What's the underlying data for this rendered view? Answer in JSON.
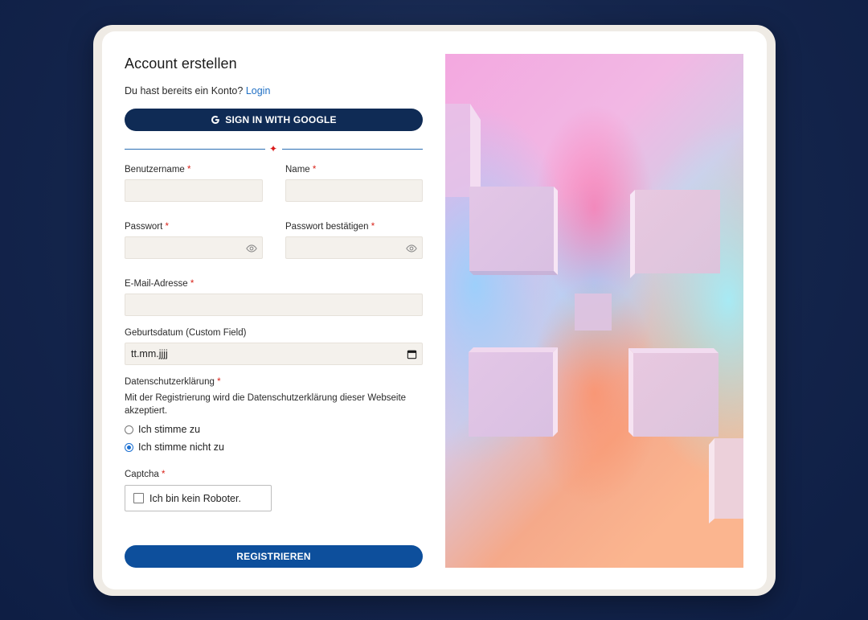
{
  "form": {
    "title": "Account erstellen",
    "login_prompt": "Du hast bereits ein Konto?",
    "login_link": "Login",
    "google_button": "SIGN IN WITH GOOGLE",
    "divider_symbol": "✦",
    "required_marker": "*",
    "fields": {
      "username": {
        "label": "Benutzername",
        "value": ""
      },
      "name": {
        "label": "Name",
        "value": ""
      },
      "password": {
        "label": "Passwort",
        "value": ""
      },
      "password_confirm": {
        "label": "Passwort bestätigen",
        "value": ""
      },
      "email": {
        "label": "E-Mail-Adresse",
        "value": ""
      },
      "birthdate": {
        "label": "Geburtsdatum (Custom Field)",
        "placeholder": "tt.mm.jjjj"
      }
    },
    "privacy": {
      "label": "Datenschutzerklärung",
      "text": "Mit der Registrierung wird die Datenschutzerklärung dieser Webseite akzeptiert.",
      "options": [
        "Ich stimme zu",
        "Ich stimme nicht zu"
      ],
      "selected": "Ich stimme nicht zu"
    },
    "captcha": {
      "label": "Captcha",
      "checkbox_text": "Ich bin kein Roboter.",
      "checked": false
    },
    "register_button": "REGISTRIEREN"
  },
  "icons": {
    "google": "google-g-icon",
    "password_toggle": "eye-icon",
    "calendar": "calendar-icon"
  },
  "colors": {
    "background": "#15264d",
    "primary_dark": "#0f2b55",
    "primary": "#0d4f9c",
    "link": "#1f6fc4",
    "required": "#d9231a",
    "input_bg": "#f4f1ec",
    "radio_accent": "#1a6fd1"
  }
}
